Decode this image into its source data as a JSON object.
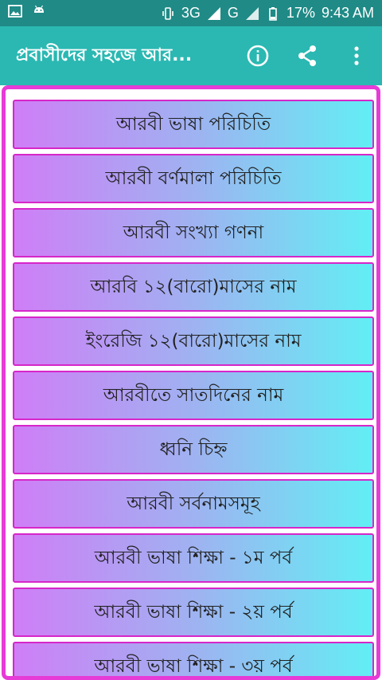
{
  "status_bar": {
    "network_3g": "3G",
    "network_g": "G",
    "battery": "17%",
    "time": "9:43 AM",
    "icons": [
      "image-icon",
      "android-icon",
      "vibrate-icon",
      "signal-icon",
      "battery-icon"
    ]
  },
  "app_bar": {
    "title": "প্রবাসীদের সহজে আর...",
    "actions": [
      "info-icon",
      "share-icon",
      "more-vert-icon"
    ],
    "color": "#2bb8b2"
  },
  "menu": {
    "items": [
      "আরবী ভাষা পরিচিতি",
      "আরবী বর্ণমালা পরিচিতি",
      "আরবী সংখ্যা গণনা",
      "আরবি ১২(বারো)মাসের নাম",
      "ইংরেজি ১২(বারো)মাসের নাম",
      "আরবীতে সাতদিনের নাম",
      "ধ্বনি চিহ্ন",
      "আরবী সর্বনামসমূহ",
      "আরবী ভাষা শিক্ষা - ১ম পর্ব",
      "আরবী ভাষা শিক্ষা - ২য় পর্ব",
      "আরবী ভাষা শিক্ষা - ৩য় পর্ব"
    ],
    "gradient": [
      "#cf7ef6",
      "#62eef4"
    ],
    "border_color": "#d726c9"
  }
}
